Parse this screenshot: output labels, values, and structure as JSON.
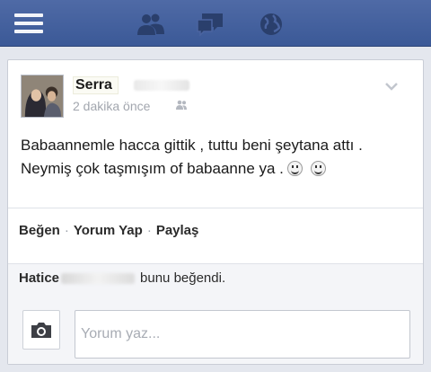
{
  "topbar": {
    "menu_icon": "hamburger-menu-icon",
    "icons": [
      "friend-requests-icon",
      "messages-icon",
      "notifications-globe-icon"
    ]
  },
  "post": {
    "author": "Serra",
    "timestamp": "2 dakika önce",
    "text_line1": "Babaannemle hacca gittik , tuttu beni şeytana attı .",
    "text_line2": "Neymiş çok taşmışım of babaanne ya ."
  },
  "actions": {
    "like": "Beğen",
    "comment": "Yorum Yap",
    "share": "Paylaş"
  },
  "likes": {
    "name": "Hatice",
    "suffix": "bunu beğendi."
  },
  "comment": {
    "placeholder": "Yorum yaz..."
  },
  "colors": {
    "topbar": "#3b5997",
    "background": "#e4e7ee",
    "card": "#ffffff"
  }
}
